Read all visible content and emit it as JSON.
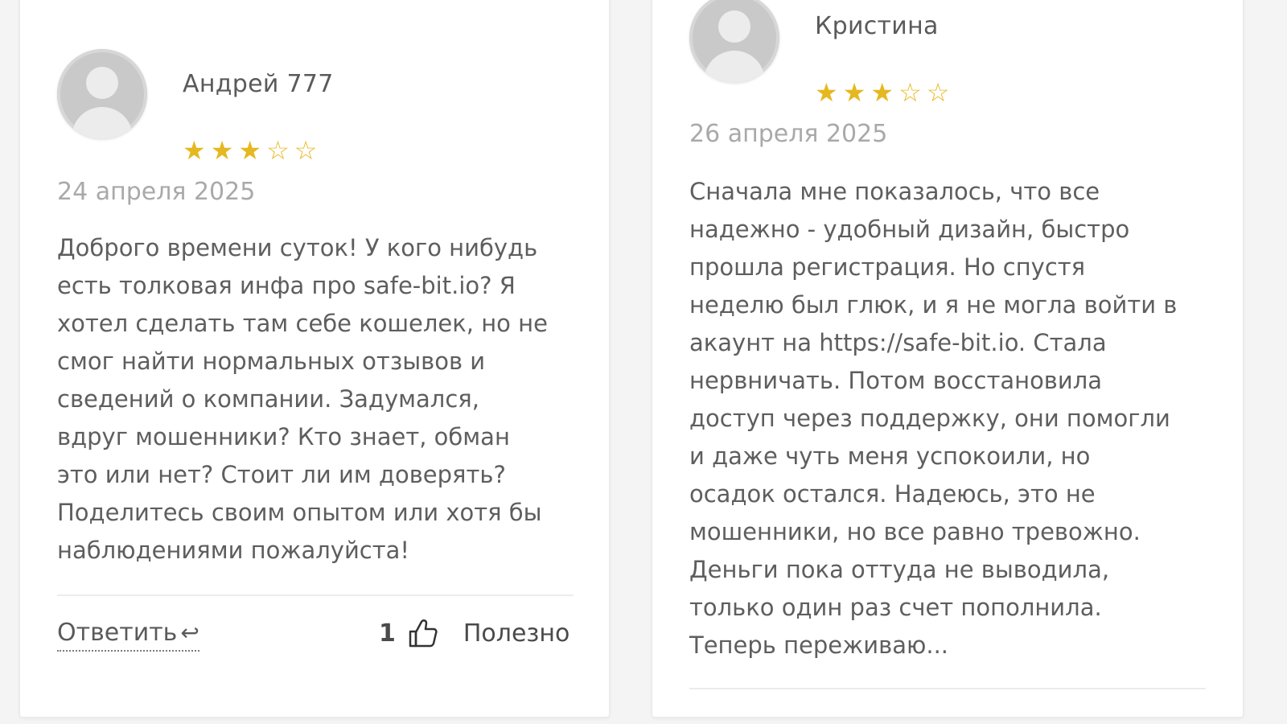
{
  "reviews": [
    {
      "author": "Андрей 777",
      "rating": 3,
      "rating_max": 5,
      "date": "24 апреля 2025",
      "text": "Доброго времени суток! У кого нибудь\nесть толковая инфа про safe-bit.io? Я\nхотел сделать там себе кошелек, но не\nсмог найти нормальных отзывов и\nсведений о компании. Задумался,\nвдруг мошенники? Кто знает, обман\nэто или нет? Стоит ли им доверять?\nПоделитесь своим опытом или хотя бы\nнаблюдениями пожалуйста!",
      "reply_label": "Ответить",
      "reply_arrow": "↩",
      "likes": "1",
      "helpful_label": "Полезно"
    },
    {
      "author": "Кристина",
      "rating": 3,
      "rating_max": 5,
      "date": "26 апреля 2025",
      "text": "Сначала мне показалось, что все\nнадежно - удобный дизайн, быстро\nпрошла регистрация. Но спустя\nнеделю был глюк, и я не могла войти в\nакаунт на https://safe-bit.io. Стала\nнервничать. Потом восстановила\nдоступ через поддержку, они помогли\nи даже чуть меня успокоили, но\nосадок остался. Надеюсь, это не\nмошенники, но все равно тревожно.\nДеньги пока оттуда не выводила,\nтолько один раз счет пополнила.\nТеперь переживаю..."
    }
  ],
  "icons": {
    "star_filled": "★",
    "star_empty": "☆",
    "thumb": "thumbs-up-icon",
    "avatar": "user-avatar-placeholder"
  },
  "colors": {
    "star": "#e6b81f",
    "date": "#a9a9a9",
    "text": "#5e5e5e"
  }
}
